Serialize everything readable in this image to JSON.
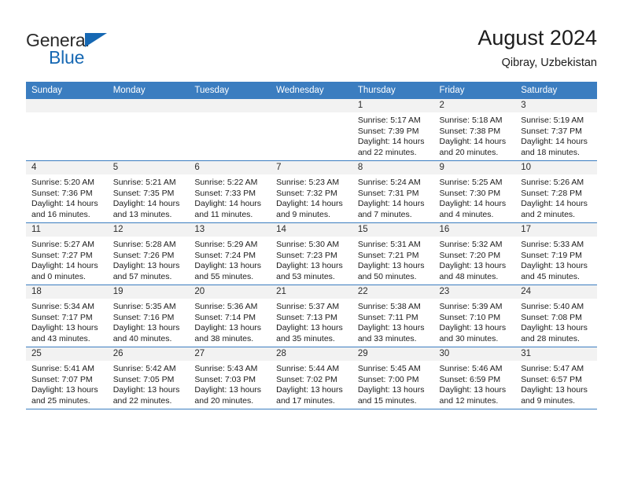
{
  "brand": {
    "name_part1": "General",
    "name_part2": "Blue",
    "triangle_color": "#1668b3"
  },
  "header": {
    "title": "August 2024",
    "subtitle": "Qibray, Uzbekistan",
    "header_bg": "#3b7dc0",
    "header_text_color": "#ffffff"
  },
  "weekdays": [
    "Sunday",
    "Monday",
    "Tuesday",
    "Wednesday",
    "Thursday",
    "Friday",
    "Saturday"
  ],
  "weeks": [
    [
      {
        "day": "",
        "empty": true,
        "sunrise": "",
        "sunset": "",
        "daylight_line1": "",
        "daylight_line2": ""
      },
      {
        "day": "",
        "empty": true,
        "sunrise": "",
        "sunset": "",
        "daylight_line1": "",
        "daylight_line2": ""
      },
      {
        "day": "",
        "empty": true,
        "sunrise": "",
        "sunset": "",
        "daylight_line1": "",
        "daylight_line2": ""
      },
      {
        "day": "",
        "empty": true,
        "sunrise": "",
        "sunset": "",
        "daylight_line1": "",
        "daylight_line2": ""
      },
      {
        "day": "1",
        "empty": false,
        "sunrise": "Sunrise: 5:17 AM",
        "sunset": "Sunset: 7:39 PM",
        "daylight_line1": "Daylight: 14 hours",
        "daylight_line2": "and 22 minutes."
      },
      {
        "day": "2",
        "empty": false,
        "sunrise": "Sunrise: 5:18 AM",
        "sunset": "Sunset: 7:38 PM",
        "daylight_line1": "Daylight: 14 hours",
        "daylight_line2": "and 20 minutes."
      },
      {
        "day": "3",
        "empty": false,
        "sunrise": "Sunrise: 5:19 AM",
        "sunset": "Sunset: 7:37 PM",
        "daylight_line1": "Daylight: 14 hours",
        "daylight_line2": "and 18 minutes."
      }
    ],
    [
      {
        "day": "4",
        "empty": false,
        "sunrise": "Sunrise: 5:20 AM",
        "sunset": "Sunset: 7:36 PM",
        "daylight_line1": "Daylight: 14 hours",
        "daylight_line2": "and 16 minutes."
      },
      {
        "day": "5",
        "empty": false,
        "sunrise": "Sunrise: 5:21 AM",
        "sunset": "Sunset: 7:35 PM",
        "daylight_line1": "Daylight: 14 hours",
        "daylight_line2": "and 13 minutes."
      },
      {
        "day": "6",
        "empty": false,
        "sunrise": "Sunrise: 5:22 AM",
        "sunset": "Sunset: 7:33 PM",
        "daylight_line1": "Daylight: 14 hours",
        "daylight_line2": "and 11 minutes."
      },
      {
        "day": "7",
        "empty": false,
        "sunrise": "Sunrise: 5:23 AM",
        "sunset": "Sunset: 7:32 PM",
        "daylight_line1": "Daylight: 14 hours",
        "daylight_line2": "and 9 minutes."
      },
      {
        "day": "8",
        "empty": false,
        "sunrise": "Sunrise: 5:24 AM",
        "sunset": "Sunset: 7:31 PM",
        "daylight_line1": "Daylight: 14 hours",
        "daylight_line2": "and 7 minutes."
      },
      {
        "day": "9",
        "empty": false,
        "sunrise": "Sunrise: 5:25 AM",
        "sunset": "Sunset: 7:30 PM",
        "daylight_line1": "Daylight: 14 hours",
        "daylight_line2": "and 4 minutes."
      },
      {
        "day": "10",
        "empty": false,
        "sunrise": "Sunrise: 5:26 AM",
        "sunset": "Sunset: 7:28 PM",
        "daylight_line1": "Daylight: 14 hours",
        "daylight_line2": "and 2 minutes."
      }
    ],
    [
      {
        "day": "11",
        "empty": false,
        "sunrise": "Sunrise: 5:27 AM",
        "sunset": "Sunset: 7:27 PM",
        "daylight_line1": "Daylight: 14 hours",
        "daylight_line2": "and 0 minutes."
      },
      {
        "day": "12",
        "empty": false,
        "sunrise": "Sunrise: 5:28 AM",
        "sunset": "Sunset: 7:26 PM",
        "daylight_line1": "Daylight: 13 hours",
        "daylight_line2": "and 57 minutes."
      },
      {
        "day": "13",
        "empty": false,
        "sunrise": "Sunrise: 5:29 AM",
        "sunset": "Sunset: 7:24 PM",
        "daylight_line1": "Daylight: 13 hours",
        "daylight_line2": "and 55 minutes."
      },
      {
        "day": "14",
        "empty": false,
        "sunrise": "Sunrise: 5:30 AM",
        "sunset": "Sunset: 7:23 PM",
        "daylight_line1": "Daylight: 13 hours",
        "daylight_line2": "and 53 minutes."
      },
      {
        "day": "15",
        "empty": false,
        "sunrise": "Sunrise: 5:31 AM",
        "sunset": "Sunset: 7:21 PM",
        "daylight_line1": "Daylight: 13 hours",
        "daylight_line2": "and 50 minutes."
      },
      {
        "day": "16",
        "empty": false,
        "sunrise": "Sunrise: 5:32 AM",
        "sunset": "Sunset: 7:20 PM",
        "daylight_line1": "Daylight: 13 hours",
        "daylight_line2": "and 48 minutes."
      },
      {
        "day": "17",
        "empty": false,
        "sunrise": "Sunrise: 5:33 AM",
        "sunset": "Sunset: 7:19 PM",
        "daylight_line1": "Daylight: 13 hours",
        "daylight_line2": "and 45 minutes."
      }
    ],
    [
      {
        "day": "18",
        "empty": false,
        "sunrise": "Sunrise: 5:34 AM",
        "sunset": "Sunset: 7:17 PM",
        "daylight_line1": "Daylight: 13 hours",
        "daylight_line2": "and 43 minutes."
      },
      {
        "day": "19",
        "empty": false,
        "sunrise": "Sunrise: 5:35 AM",
        "sunset": "Sunset: 7:16 PM",
        "daylight_line1": "Daylight: 13 hours",
        "daylight_line2": "and 40 minutes."
      },
      {
        "day": "20",
        "empty": false,
        "sunrise": "Sunrise: 5:36 AM",
        "sunset": "Sunset: 7:14 PM",
        "daylight_line1": "Daylight: 13 hours",
        "daylight_line2": "and 38 minutes."
      },
      {
        "day": "21",
        "empty": false,
        "sunrise": "Sunrise: 5:37 AM",
        "sunset": "Sunset: 7:13 PM",
        "daylight_line1": "Daylight: 13 hours",
        "daylight_line2": "and 35 minutes."
      },
      {
        "day": "22",
        "empty": false,
        "sunrise": "Sunrise: 5:38 AM",
        "sunset": "Sunset: 7:11 PM",
        "daylight_line1": "Daylight: 13 hours",
        "daylight_line2": "and 33 minutes."
      },
      {
        "day": "23",
        "empty": false,
        "sunrise": "Sunrise: 5:39 AM",
        "sunset": "Sunset: 7:10 PM",
        "daylight_line1": "Daylight: 13 hours",
        "daylight_line2": "and 30 minutes."
      },
      {
        "day": "24",
        "empty": false,
        "sunrise": "Sunrise: 5:40 AM",
        "sunset": "Sunset: 7:08 PM",
        "daylight_line1": "Daylight: 13 hours",
        "daylight_line2": "and 28 minutes."
      }
    ],
    [
      {
        "day": "25",
        "empty": false,
        "sunrise": "Sunrise: 5:41 AM",
        "sunset": "Sunset: 7:07 PM",
        "daylight_line1": "Daylight: 13 hours",
        "daylight_line2": "and 25 minutes."
      },
      {
        "day": "26",
        "empty": false,
        "sunrise": "Sunrise: 5:42 AM",
        "sunset": "Sunset: 7:05 PM",
        "daylight_line1": "Daylight: 13 hours",
        "daylight_line2": "and 22 minutes."
      },
      {
        "day": "27",
        "empty": false,
        "sunrise": "Sunrise: 5:43 AM",
        "sunset": "Sunset: 7:03 PM",
        "daylight_line1": "Daylight: 13 hours",
        "daylight_line2": "and 20 minutes."
      },
      {
        "day": "28",
        "empty": false,
        "sunrise": "Sunrise: 5:44 AM",
        "sunset": "Sunset: 7:02 PM",
        "daylight_line1": "Daylight: 13 hours",
        "daylight_line2": "and 17 minutes."
      },
      {
        "day": "29",
        "empty": false,
        "sunrise": "Sunrise: 5:45 AM",
        "sunset": "Sunset: 7:00 PM",
        "daylight_line1": "Daylight: 13 hours",
        "daylight_line2": "and 15 minutes."
      },
      {
        "day": "30",
        "empty": false,
        "sunrise": "Sunrise: 5:46 AM",
        "sunset": "Sunset: 6:59 PM",
        "daylight_line1": "Daylight: 13 hours",
        "daylight_line2": "and 12 minutes."
      },
      {
        "day": "31",
        "empty": false,
        "sunrise": "Sunrise: 5:47 AM",
        "sunset": "Sunset: 6:57 PM",
        "daylight_line1": "Daylight: 13 hours",
        "daylight_line2": "and 9 minutes."
      }
    ]
  ]
}
